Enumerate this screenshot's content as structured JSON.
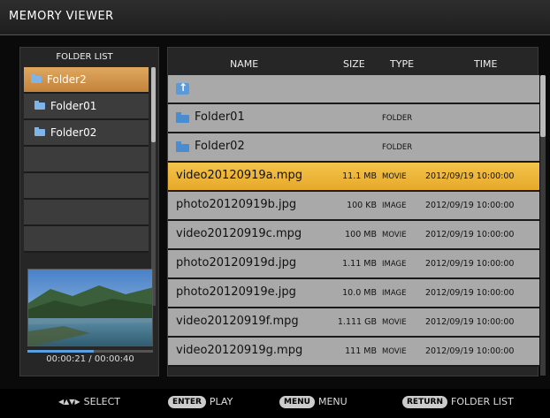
{
  "window": {
    "title": "MEMORY VIEWER"
  },
  "folder_list": {
    "header": "FOLDER LIST",
    "items": [
      {
        "label": "Folder2",
        "selected": true
      },
      {
        "label": "Folder01",
        "selected": false
      },
      {
        "label": "Folder02",
        "selected": false
      },
      {
        "label": "",
        "selected": false
      },
      {
        "label": "",
        "selected": false
      },
      {
        "label": "",
        "selected": false
      },
      {
        "label": "",
        "selected": false
      }
    ]
  },
  "preview": {
    "timecode": "00:00:21 / 00:00:40",
    "progress": 0.525
  },
  "file_table": {
    "columns": {
      "name": "NAME",
      "size": "SIZE",
      "type": "TYPE",
      "time": "TIME"
    },
    "rows": [
      {
        "kind": "up",
        "name": "",
        "size": "",
        "type": "",
        "time": ""
      },
      {
        "kind": "folder",
        "name": "Folder01",
        "size": "",
        "type": "FOLDER",
        "time": ""
      },
      {
        "kind": "folder",
        "name": "Folder02",
        "size": "",
        "type": "FOLDER",
        "time": ""
      },
      {
        "kind": "file",
        "name": "video20120919a.mpg",
        "size": "11.1 MB",
        "type": "MOVIE",
        "time": "2012/09/19 10:00:00",
        "selected": true
      },
      {
        "kind": "file",
        "name": "photo20120919b.jpg",
        "size": "100 KB",
        "type": "IMAGE",
        "time": "2012/09/19 10:00:00"
      },
      {
        "kind": "file",
        "name": "video20120919c.mpg",
        "size": "100 MB",
        "type": "MOVIE",
        "time": "2012/09/19 10:00:00"
      },
      {
        "kind": "file",
        "name": "photo20120919d.jpg",
        "size": "1.11 MB",
        "type": "IMAGE",
        "time": "2012/09/19 10:00:00"
      },
      {
        "kind": "file",
        "name": "photo20120919e.jpg",
        "size": "10.0 MB",
        "type": "IMAGE",
        "time": "2012/09/19 10:00:00"
      },
      {
        "kind": "file",
        "name": "video20120919f.mpg",
        "size": "1.111 GB",
        "type": "MOVIE",
        "time": "2012/09/19 10:00:00"
      },
      {
        "kind": "file",
        "name": "video20120919g.mpg",
        "size": "111 MB",
        "type": "MOVIE",
        "time": "2012/09/19 10:00:00"
      }
    ]
  },
  "footer": {
    "select_label": "SELECT",
    "enter_key": "ENTER",
    "enter_label": "PLAY",
    "menu_key": "MENU",
    "menu_label": "MENU",
    "return_key": "RETURN",
    "return_label": "FOLDER LIST"
  },
  "colors": {
    "selected_folder": "#d4944c",
    "selected_file": "#efb93a",
    "row_bg": "#a9a9a9"
  }
}
